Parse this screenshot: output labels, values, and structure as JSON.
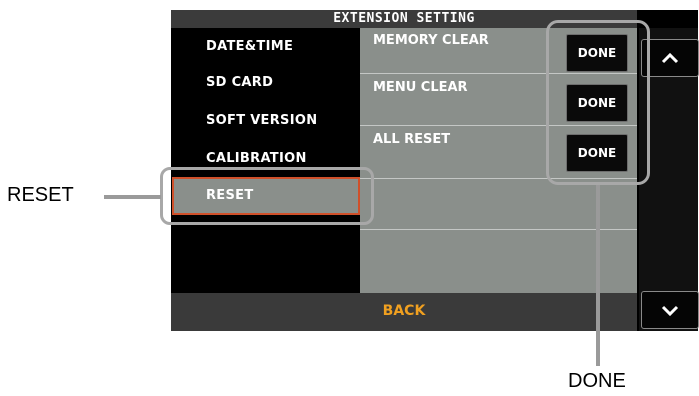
{
  "screen": {
    "title": "EXTENSION SETTING",
    "menu_items": [
      {
        "label": "DATE&TIME"
      },
      {
        "label": "SD CARD"
      },
      {
        "label": "SOFT VERSION"
      },
      {
        "label": "CALIBRATION"
      },
      {
        "label": "RESET"
      }
    ],
    "rows": [
      {
        "label": "MEMORY CLEAR",
        "button": "DONE"
      },
      {
        "label": "MENU CLEAR",
        "button": "DONE"
      },
      {
        "label": "ALL RESET",
        "button": "DONE"
      }
    ],
    "back_label": "BACK",
    "scroll_up_icon": "chevron-up-icon",
    "scroll_down_icon": "chevron-down-icon"
  },
  "annotations": {
    "reset_label": "RESET",
    "done_label": "DONE"
  },
  "colors": {
    "content_bg": "#8a8f8b",
    "back_text": "#f0a020",
    "selected_border": "#d0502a",
    "callout": "#a8a8a8"
  }
}
